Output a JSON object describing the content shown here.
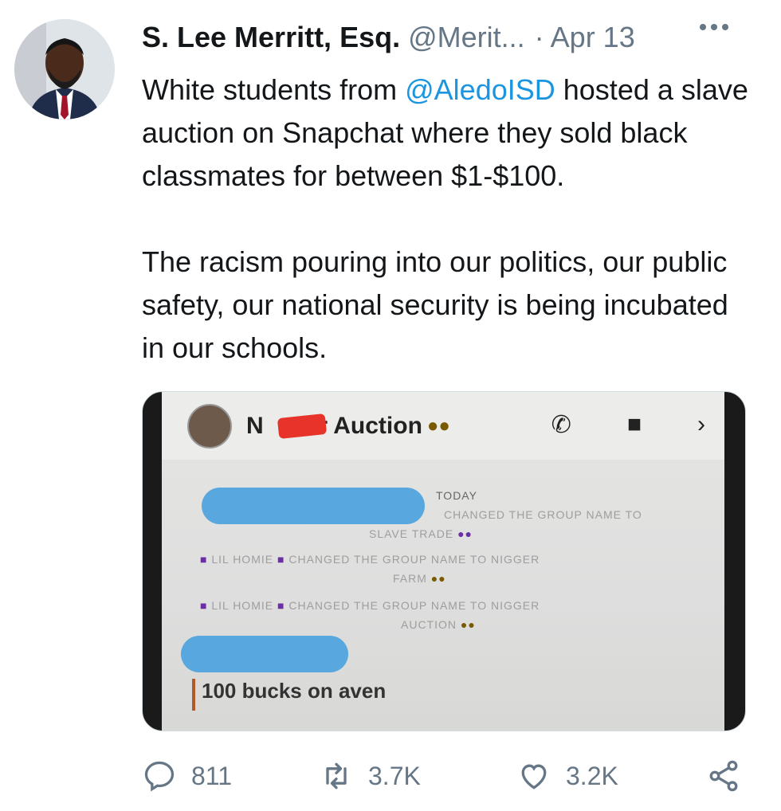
{
  "tweet": {
    "author_name": "S. Lee Merritt, Esq.",
    "handle": "@Merit...",
    "separator": "·",
    "date": "Apr 13",
    "body": {
      "p1_before": "White students from ",
      "mention": "@AledoISD",
      "p1_after": " hosted a slave auction on Snapchat where they sold black classmates for between $1-$100.",
      "p2": "The racism pouring into our politics, our public safety, our national security is being incubated in our schools."
    },
    "media": {
      "chat_title_start": "N",
      "chat_title_end": "er Auction",
      "day_label": "TODAY",
      "notice_1a": "CHANGED THE GROUP NAME TO",
      "notice_1b": "SLAVE TRADE",
      "notice_2a": "LIL HOMIE",
      "notice_2b": "CHANGED THE GROUP NAME TO NIGGER",
      "notice_2c": "FARM",
      "notice_3a": "LIL HOMIE",
      "notice_3b": "CHANGED THE GROUP NAME TO NIGGER",
      "notice_3c": "AUCTION",
      "last_message": "100 bucks on aven"
    },
    "stats": {
      "replies": "811",
      "retweets": "3.7K",
      "likes": "3.2K"
    }
  },
  "icons": {
    "reply": "reply-icon",
    "retweet": "retweet-icon",
    "like": "heart-icon",
    "share": "share-icon",
    "more": "more-icon"
  },
  "colors": {
    "text": "#14171a",
    "secondary": "#657786",
    "link": "#1b95e0",
    "redaction": "#e8332a",
    "highlight_bar": "#58a7de"
  }
}
